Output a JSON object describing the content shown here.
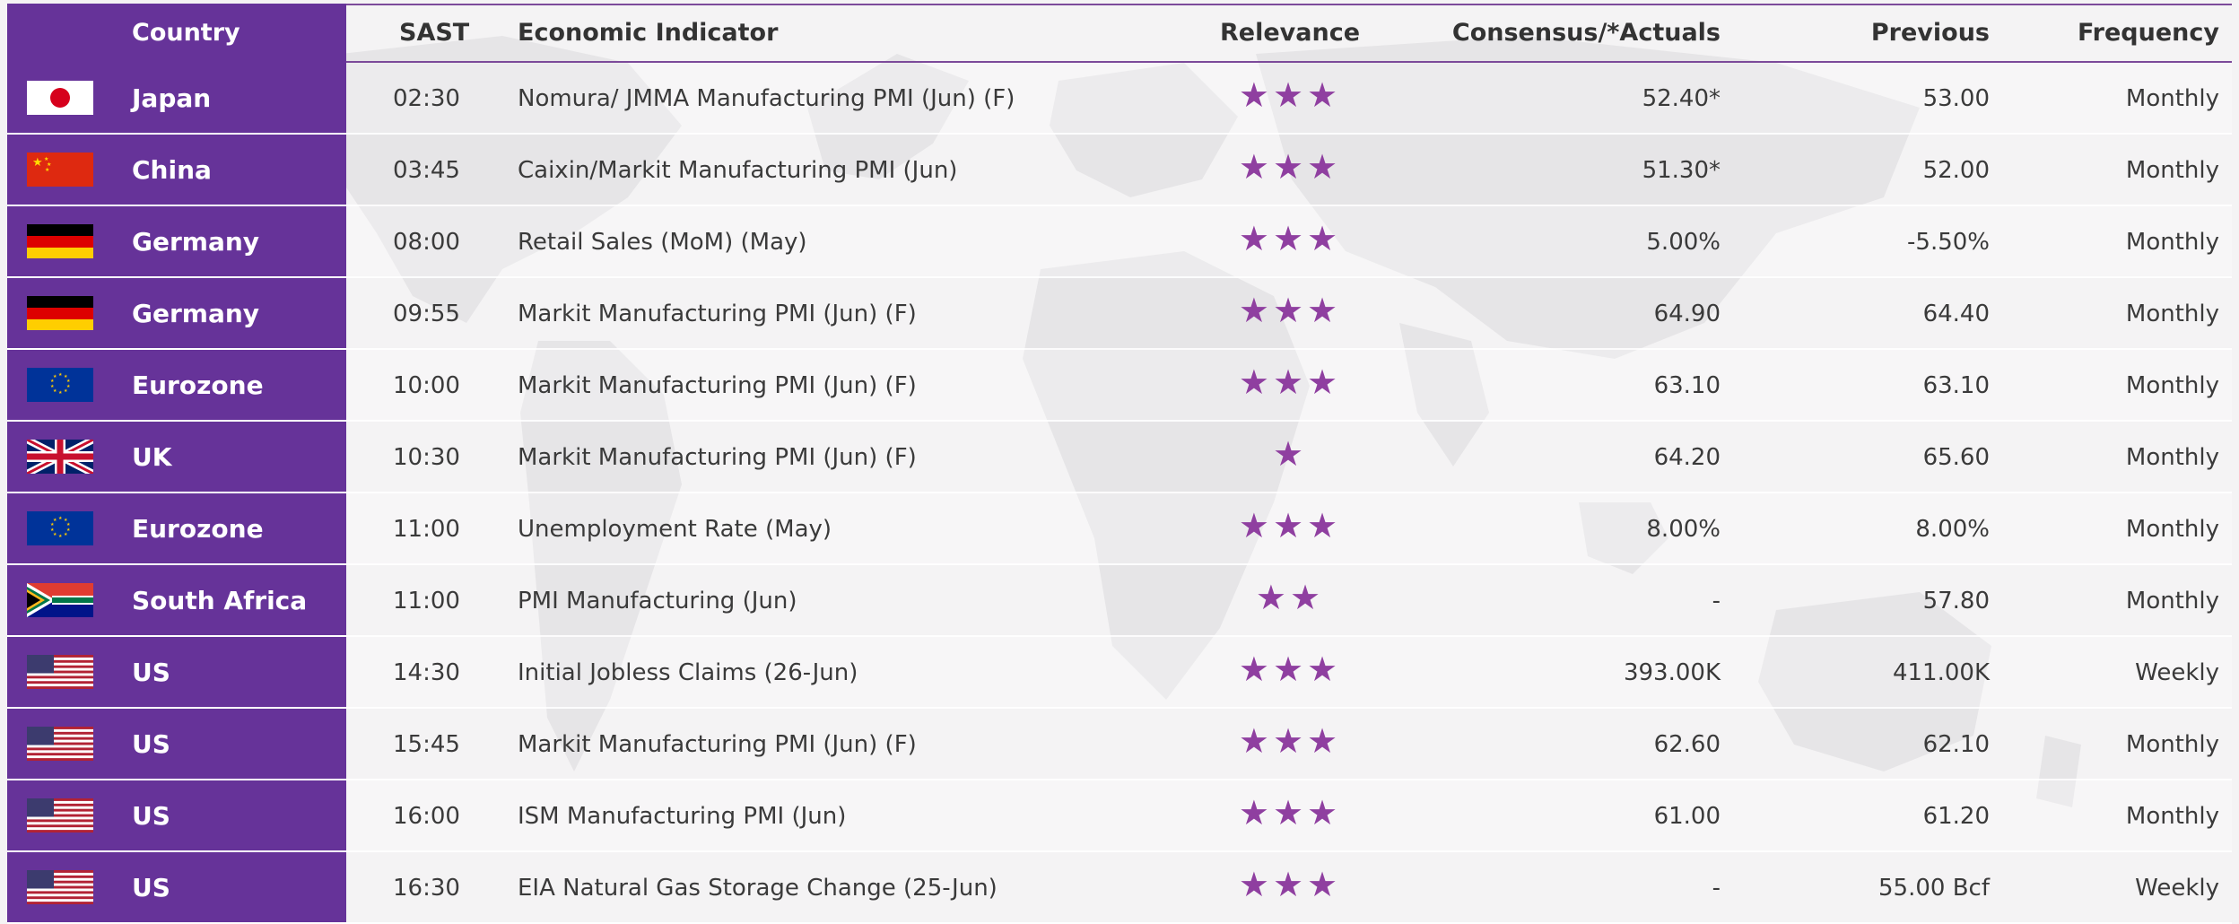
{
  "header": {
    "country": "Country",
    "sast": "SAST",
    "indicator": "Economic Indicator",
    "relevance": "Relevance",
    "consensus": "Consensus/*Actuals",
    "previous": "Previous",
    "frequency": "Frequency"
  },
  "star_color": "#8f3fa0",
  "country_bg": "#663399",
  "rows": [
    {
      "country": "Japan",
      "flag": "japan-flag",
      "time": "02:30",
      "indicator": "Nomura/ JMMA Manufacturing PMI (Jun) (F)",
      "stars": "★★★",
      "consensus": "52.40*",
      "previous": "53.00",
      "frequency": "Monthly"
    },
    {
      "country": "China",
      "flag": "china-flag",
      "time": "03:45",
      "indicator": "Caixin/Markit Manufacturing PMI (Jun)",
      "stars": "★★★",
      "consensus": "51.30*",
      "previous": "52.00",
      "frequency": "Monthly"
    },
    {
      "country": "Germany",
      "flag": "germany-flag",
      "time": "08:00",
      "indicator": "Retail Sales (MoM) (May)",
      "stars": "★★★",
      "consensus": "5.00%",
      "previous": "-5.50%",
      "frequency": "Monthly"
    },
    {
      "country": "Germany",
      "flag": "germany-flag",
      "time": "09:55",
      "indicator": "Markit Manufacturing PMI (Jun) (F)",
      "stars": "★★★",
      "consensus": "64.90",
      "previous": "64.40",
      "frequency": "Monthly"
    },
    {
      "country": "Eurozone",
      "flag": "eu-flag",
      "time": "10:00",
      "indicator": "Markit Manufacturing PMI (Jun) (F)",
      "stars": "★★★",
      "consensus": "63.10",
      "previous": "63.10",
      "frequency": "Monthly"
    },
    {
      "country": "UK",
      "flag": "uk-flag",
      "time": "10:30",
      "indicator": "Markit Manufacturing PMI (Jun) (F)",
      "stars": "★",
      "consensus": "64.20",
      "previous": "65.60",
      "frequency": "Monthly"
    },
    {
      "country": "Eurozone",
      "flag": "eu-flag",
      "time": "11:00",
      "indicator": "Unemployment Rate (May)",
      "stars": "★★★",
      "consensus": "8.00%",
      "previous": "8.00%",
      "frequency": "Monthly"
    },
    {
      "country": "South Africa",
      "flag": "south-africa-flag",
      "time": "11:00",
      "indicator": "PMI Manufacturing (Jun)",
      "stars": "★★",
      "consensus": "-",
      "previous": "57.80",
      "frequency": "Monthly"
    },
    {
      "country": "US",
      "flag": "us-flag",
      "time": "14:30",
      "indicator": "Initial Jobless Claims (26-Jun)",
      "stars": "★★★",
      "consensus": "393.00K",
      "previous": "411.00K",
      "frequency": "Weekly"
    },
    {
      "country": "US",
      "flag": "us-flag",
      "time": "15:45",
      "indicator": "Markit Manufacturing PMI (Jun) (F)",
      "stars": "★★★",
      "consensus": "62.60",
      "previous": "62.10",
      "frequency": "Monthly"
    },
    {
      "country": "US",
      "flag": "us-flag",
      "time": "16:00",
      "indicator": "ISM Manufacturing PMI (Jun)",
      "stars": "★★★",
      "consensus": "61.00",
      "previous": "61.20",
      "frequency": "Monthly"
    },
    {
      "country": "US",
      "flag": "us-flag",
      "time": "16:30",
      "indicator": "EIA Natural Gas Storage Change (25-Jun)",
      "stars": "★★★",
      "consensus": "-",
      "previous": "55.00 Bcf",
      "frequency": "Weekly"
    }
  ]
}
